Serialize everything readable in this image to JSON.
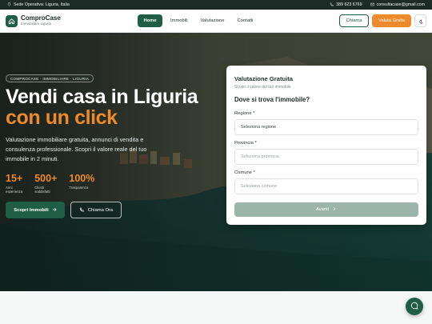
{
  "topbar": {
    "location": "Sede Operativa: Liguria, Italia",
    "phone": "389 623 6769",
    "email": "consultacase@gmail.com"
  },
  "header": {
    "brand_name": "ComproCase",
    "brand_sub": "Immobiliare Liguria",
    "nav": [
      "Home",
      "Immobili",
      "Valutazione",
      "Contatti"
    ],
    "active_nav": "Home",
    "call_label": "Chiama",
    "valuation_label": "Valuta Gratis"
  },
  "hero": {
    "badge": "COMPROCASE · IMMOBILIARE · LIGURIA",
    "title_line1": "Vendi casa in Liguria",
    "title_line2": "con un click",
    "description": "Valutazione immobiliare gratuita, annunci di vendita e consulenza professionale. Scopri il valore reale del tuo immobile in 2 minuti.",
    "stats": [
      {
        "value": "15+",
        "label": "Anni esperienza"
      },
      {
        "value": "500+",
        "label": "Clienti soddisfatti"
      },
      {
        "value": "100%",
        "label": "Trasparenza"
      }
    ],
    "primary_button": "Scopri Immobili",
    "secondary_button": "Chiama Ora"
  },
  "form": {
    "title": "Valutazione Gratuita",
    "subtitle": "Scopri il valore del tuo immobile",
    "question": "Dove si trova l'immobile?",
    "region_label": "Regione *",
    "region_value": "Seleziona regione",
    "province_label": "Provincia *",
    "province_value": "Seleziona provincia",
    "municipality_label": "Comune *",
    "municipality_value": "Seleziona comune",
    "next_button": "Avanti"
  },
  "colors": {
    "brand_green": "#1f5d46",
    "accent_orange": "#ee8a2b",
    "topbar": "#1c2b26"
  }
}
